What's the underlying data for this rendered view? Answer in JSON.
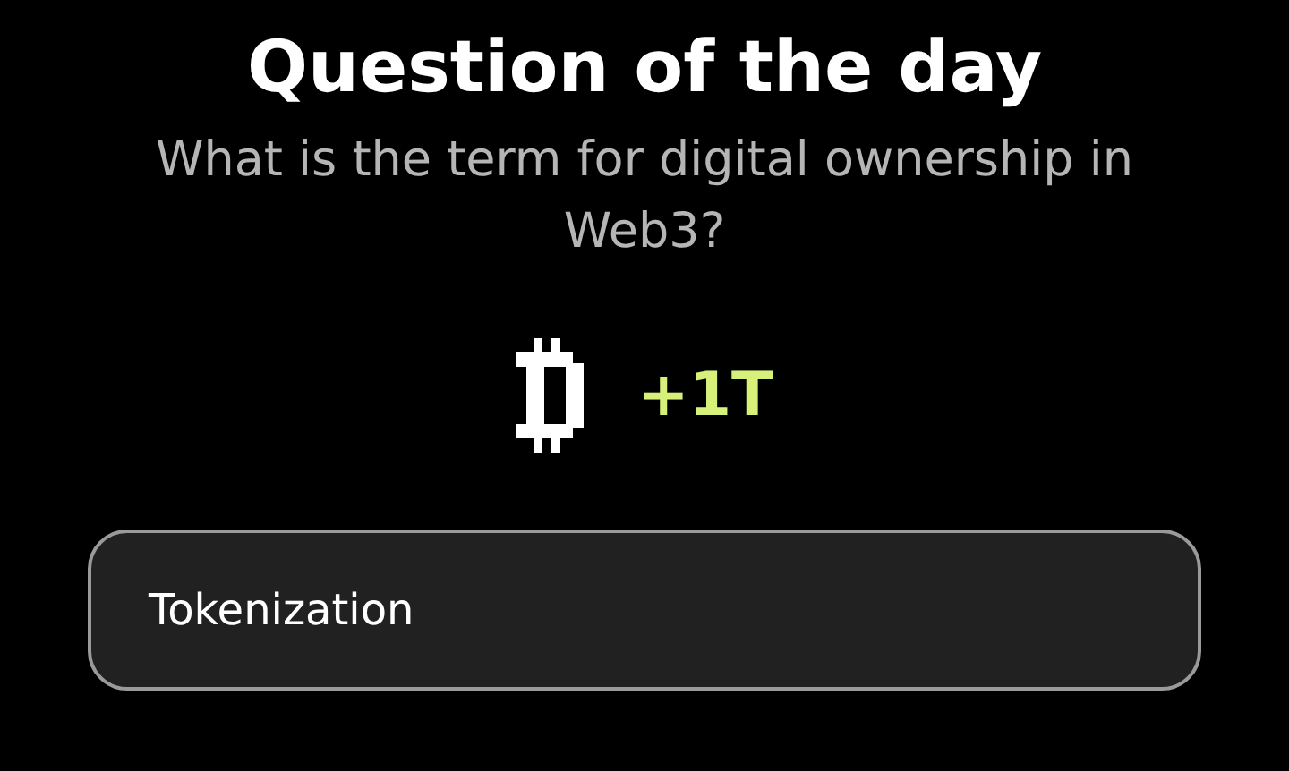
{
  "title": "Question of the day",
  "question": "What is the term for digital ownership in Web3?",
  "reward": {
    "amount": "+1T"
  },
  "options": [
    {
      "label": "Tokenization",
      "selected": false
    }
  ]
}
